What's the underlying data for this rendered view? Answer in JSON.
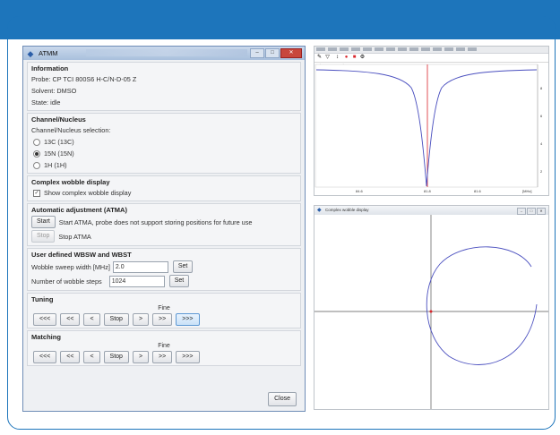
{
  "colors": {
    "brand_blue": "#1d75bb",
    "window_bg": "#eef0f3",
    "curve_blue": "#4a4fbf",
    "marker_red": "#d9262c"
  },
  "atmm": {
    "title": "ATMM",
    "information": {
      "heading": "Information",
      "probe": "Probe: CP TCI 800S6 H-C/N-D-05 Z",
      "solvent": "Solvent: DMSO",
      "state": "State: idle"
    },
    "channel": {
      "heading": "Channel/Nucleus",
      "selection_label": "Channel/Nucleus selection:",
      "options": [
        {
          "label": "13C (13C)",
          "selected": false
        },
        {
          "label": "15N (15N)",
          "selected": true
        },
        {
          "label": "1H (1H)",
          "selected": false
        }
      ]
    },
    "complex": {
      "heading": "Complex wobble display",
      "checkbox_label": "Show complex wobble display",
      "checked": true
    },
    "atma": {
      "heading": "Automatic adjustment (ATMA)",
      "start_label": "Start",
      "start_text": "Start ATMA, probe does not support storing positions for future use",
      "stop_label": "Stop",
      "stop_text": "Stop ATMA"
    },
    "wbsw": {
      "heading": "User defined WBSW and WBST",
      "sweep_label": "Wobble sweep width [MHz]",
      "sweep_value": "2.0",
      "steps_label": "Number of wobble steps",
      "steps_value": "1024",
      "set_label": "Set"
    },
    "tuning": {
      "heading": "Tuning",
      "fine_label": "Fine",
      "buttons": [
        "<<<",
        "<<",
        "<",
        "Stop",
        ">",
        ">>",
        ">>>"
      ]
    },
    "matching": {
      "heading": "Matching",
      "fine_label": "Fine",
      "buttons": [
        "<<<",
        "<<",
        "<",
        "Stop",
        ">",
        ">>",
        ">>>"
      ]
    },
    "close_label": "Close"
  },
  "curve_window": {
    "trace_label": "wj 1 + 0 Dataview",
    "subtitle": "Normalized",
    "x_ticks": [
      "84.6",
      "81.8",
      "81.6",
      "81.4"
    ],
    "unit": "[MHz]",
    "y_ticks": [
      "8",
      "6",
      "4",
      "2"
    ]
  },
  "complex_window": {
    "title": "Complex wobble display"
  }
}
